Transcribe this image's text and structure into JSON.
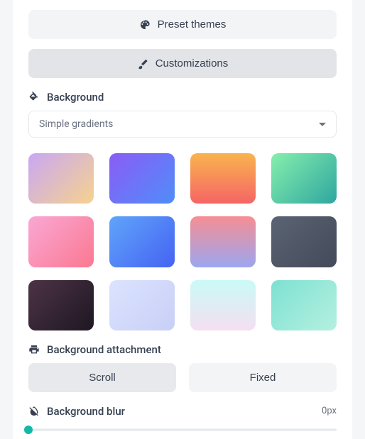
{
  "tabs": {
    "preset": "Preset themes",
    "custom": "Customizations"
  },
  "background": {
    "label": "Background",
    "select_value": "Simple gradients",
    "swatches": [
      {
        "name": "pink-to-peach",
        "css": "linear-gradient(135deg,#c9a7f3,#f6d28e)"
      },
      {
        "name": "violet-to-blue",
        "css": "linear-gradient(135deg,#8b5cf6,#4f8df9)"
      },
      {
        "name": "orange-to-red",
        "css": "linear-gradient(180deg,#f9b44e,#f56565)"
      },
      {
        "name": "mint-to-teal",
        "css": "linear-gradient(135deg,#86efac,#2ea6a0)"
      },
      {
        "name": "pink-to-coral",
        "css": "linear-gradient(135deg,#f9a8d4,#fb7891)"
      },
      {
        "name": "blue-to-indigo",
        "css": "linear-gradient(135deg,#60a5fa,#4562f3)"
      },
      {
        "name": "rose-to-lavender",
        "css": "linear-gradient(180deg,#f68e94,#9ca6ef)"
      },
      {
        "name": "slate-dark",
        "css": "linear-gradient(135deg,#5b6474,#434a59)"
      },
      {
        "name": "dark-plum",
        "css": "linear-gradient(135deg,#4c3346,#1e1722)"
      },
      {
        "name": "pale-lavender",
        "css": "linear-gradient(135deg,#dbe3ff,#c8cff6)"
      },
      {
        "name": "pale-mint-pink",
        "css": "linear-gradient(180deg,#c9faf6,#f5dff1)"
      },
      {
        "name": "aqua-to-seafoam",
        "css": "linear-gradient(135deg,#7de1d1,#b5f0e0)"
      }
    ]
  },
  "attachment": {
    "label": "Background attachment",
    "options": [
      "Scroll",
      "Fixed"
    ],
    "selected": "Scroll"
  },
  "blur": {
    "label": "Background blur",
    "value_text": "0px",
    "value_pct": 0
  }
}
